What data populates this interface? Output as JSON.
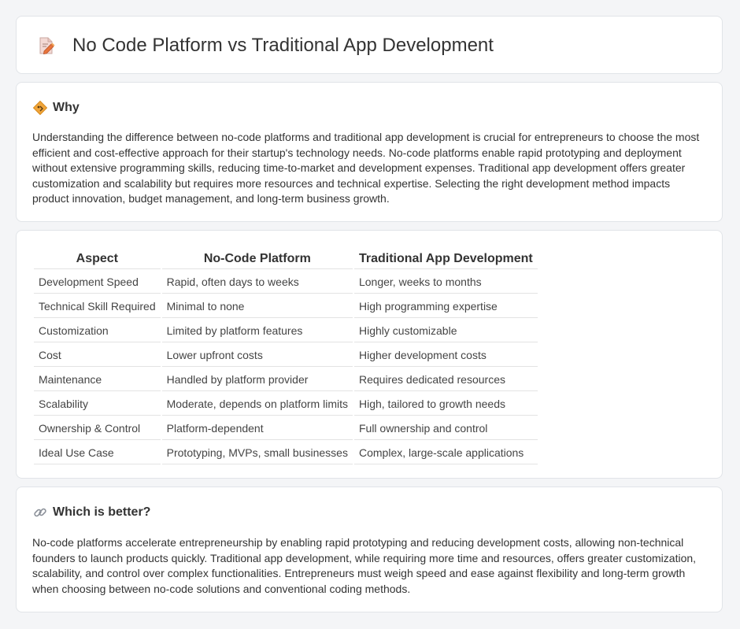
{
  "header": {
    "title": "No Code Platform vs Traditional App Development",
    "icon": "document-pencil-icon"
  },
  "why": {
    "icon": "diamond-warning-icon",
    "heading": "Why",
    "body": "Understanding the difference between no-code platforms and traditional app development is crucial for entrepreneurs to choose the most efficient and cost-effective approach for their startup's technology needs. No-code platforms enable rapid prototyping and deployment without extensive programming skills, reducing time-to-market and development expenses. Traditional app development offers greater customization and scalability but requires more resources and technical expertise. Selecting the right development method impacts product innovation, budget management, and long-term business growth."
  },
  "comparison": {
    "columns": [
      "Aspect",
      "No-Code Platform",
      "Traditional App Development"
    ],
    "rows": [
      [
        "Development Speed",
        "Rapid, often days to weeks",
        "Longer, weeks to months"
      ],
      [
        "Technical Skill Required",
        "Minimal to none",
        "High programming expertise"
      ],
      [
        "Customization",
        "Limited by platform features",
        "Highly customizable"
      ],
      [
        "Cost",
        "Lower upfront costs",
        "Higher development costs"
      ],
      [
        "Maintenance",
        "Handled by platform provider",
        "Requires dedicated resources"
      ],
      [
        "Scalability",
        "Moderate, depends on platform limits",
        "High, tailored to growth needs"
      ],
      [
        "Ownership & Control",
        "Platform-dependent",
        "Full ownership and control"
      ],
      [
        "Ideal Use Case",
        "Prototyping, MVPs, small businesses",
        "Complex, large-scale applications"
      ]
    ]
  },
  "better": {
    "icon": "link-icon",
    "heading": "Which is better?",
    "body": "No-code platforms accelerate entrepreneurship by enabling rapid prototyping and reducing development costs, allowing non-technical founders to launch products quickly. Traditional app development, while requiring more time and resources, offers greater customization, scalability, and control over complex functionalities. Entrepreneurs must weigh speed and ease against flexibility and long-term growth when choosing between no-code solutions and conventional coding methods."
  }
}
